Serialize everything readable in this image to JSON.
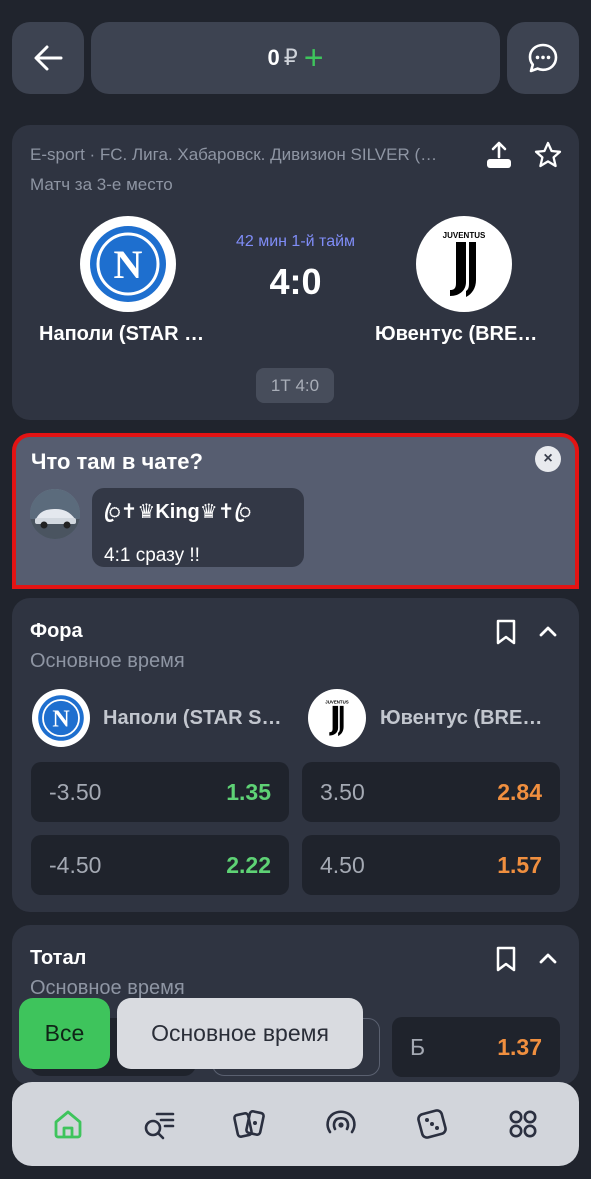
{
  "header": {
    "balance": "0",
    "currency": "₽",
    "add_symbol": "+"
  },
  "match": {
    "league": "E-sport · FC. Лига. Хабаровск. Дивизион SILVER (…",
    "stage": "Матч за 3-е место",
    "time": "42 мин 1-й тайм",
    "score": "4:0",
    "period_score": "1Т 4:0",
    "home": {
      "name": "Наполи (STAR …",
      "logo_letter": "N"
    },
    "away": {
      "name": "Ювентус (BRE…",
      "logo_text": "JUVENTUS"
    }
  },
  "chat": {
    "title": "Что там в чате?",
    "close_symbol": "×",
    "user": "ꦿ✝♛King♛✝ꦿ",
    "message": "4:1 сразу !!"
  },
  "fora": {
    "title": "Фора",
    "subtitle": "Основное время",
    "home_name": "Наполи (STAR S…",
    "away_name": "Ювентус (BRE…",
    "rows": [
      {
        "home_line": "-3.50",
        "home_odd": "1.35",
        "away_line": "3.50",
        "away_odd": "2.84"
      },
      {
        "home_line": "-4.50",
        "home_odd": "2.22",
        "away_line": "4.50",
        "away_odd": "1.57"
      }
    ]
  },
  "total": {
    "title": "Тотал",
    "subtitle": "Основное время",
    "odd_label": "Б",
    "odd_value": "1.37"
  },
  "filters": {
    "all": "Все",
    "main_time": "Основное время"
  },
  "nav": [
    "home-icon",
    "search-list-icon",
    "cards-icon",
    "live-icon",
    "dice-icon",
    "grid-icon"
  ],
  "colors": {
    "accent_green": "#3ec45c",
    "odd_green": "#5ed275",
    "odd_orange": "#f08f3f",
    "live_time": "#7f8cf6",
    "highlight_red": "#e31313"
  }
}
